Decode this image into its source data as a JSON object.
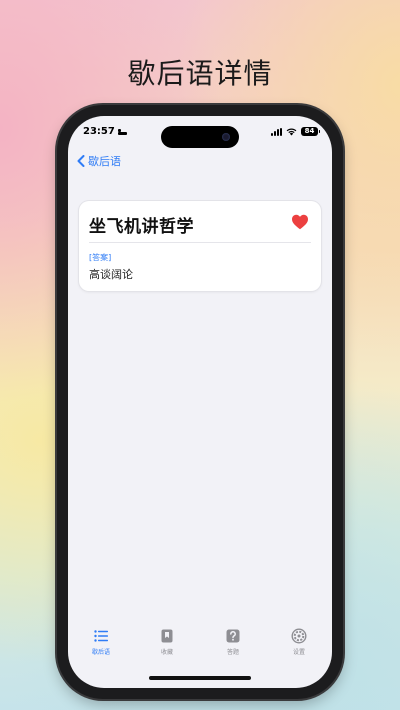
{
  "headline": "歇后语详情",
  "status_bar": {
    "time": "23:57",
    "battery": "84"
  },
  "nav": {
    "back_label": "歇后语"
  },
  "detail": {
    "riddle": "坐飞机讲哲学",
    "answer_label": "[答案]",
    "answer": "高谈阔论",
    "favorited": true
  },
  "tabs": [
    {
      "label": "歇后语",
      "icon": "list-icon",
      "active": true
    },
    {
      "label": "收藏",
      "icon": "bookmark-icon",
      "active": false
    },
    {
      "label": "答题",
      "icon": "question-icon",
      "active": false
    },
    {
      "label": "设置",
      "icon": "gear-icon",
      "active": false
    }
  ],
  "colors": {
    "accent": "#2f7cf6",
    "heart": "#ec4040",
    "inactive": "#8e8e93"
  }
}
